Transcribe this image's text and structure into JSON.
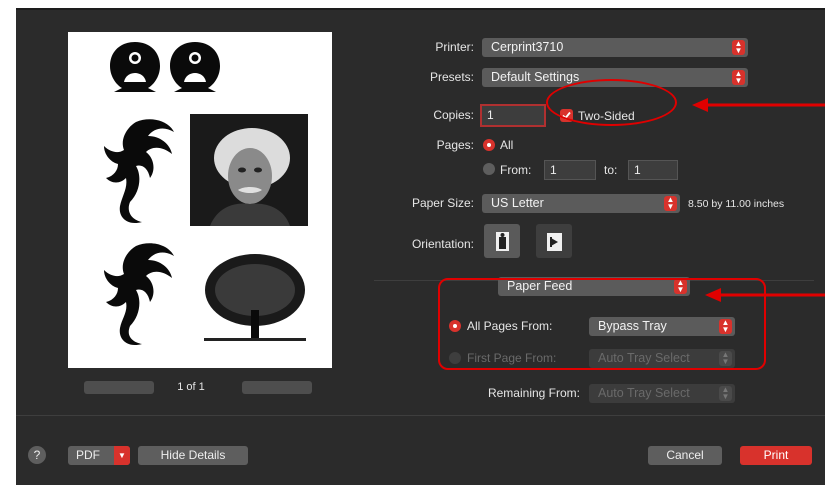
{
  "printer": {
    "label": "Printer:",
    "value": "Cerprint3710"
  },
  "presets": {
    "label": "Presets:",
    "value": "Default Settings"
  },
  "copies": {
    "label": "Copies:",
    "value": "1",
    "two_sided_label": "Two-Sided",
    "two_sided_checked": true
  },
  "pages": {
    "label": "Pages:",
    "all_label": "All",
    "from_label": "From:",
    "from_value": "1",
    "to_label": "to:",
    "to_value": "1"
  },
  "paper_size": {
    "label": "Paper Size:",
    "value": "US Letter",
    "dimensions": "8.50 by 11.00 inches"
  },
  "orientation": {
    "label": "Orientation:"
  },
  "section_popup": {
    "value": "Paper Feed"
  },
  "paper_feed": {
    "all_pages_label": "All Pages From:",
    "all_pages_value": "Bypass Tray",
    "first_page_label": "First Page From:",
    "first_page_value": "Auto Tray Select",
    "remaining_label": "Remaining From:",
    "remaining_value": "Auto Tray Select"
  },
  "preview": {
    "page_indicator": "1 of 1"
  },
  "footer": {
    "help": "?",
    "pdf": "PDF",
    "hide_details": "Hide Details",
    "cancel": "Cancel",
    "print": "Print"
  },
  "colors": {
    "accent": "#d8322c",
    "annotation": "#e00000",
    "background": "#2b2b2b"
  },
  "icons": [
    "portrait-orientation-icon",
    "landscape-orientation-icon",
    "red-arrow-icon",
    "checkbox-checked-icon"
  ]
}
